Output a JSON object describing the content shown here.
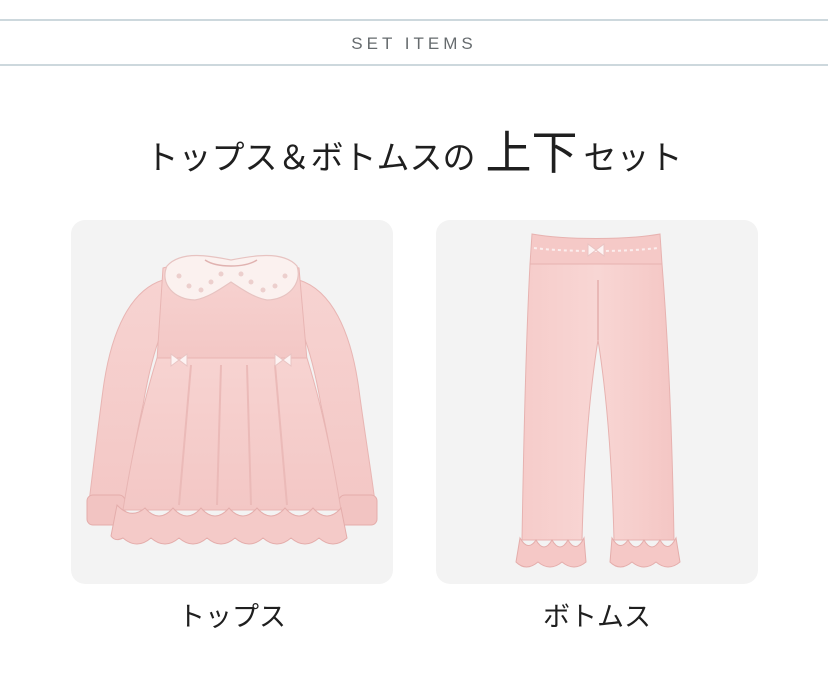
{
  "header": {
    "section_title": "SET ITEMS"
  },
  "headline": {
    "before": "トップス＆ボトムスの",
    "emphasis": "上下",
    "after": "セット"
  },
  "products": [
    {
      "caption": "トップス",
      "image_icon": "pink-fleece-top-image"
    },
    {
      "caption": "ボトムス",
      "image_icon": "pink-fleece-pants-image"
    }
  ],
  "colors": {
    "rule": "#cdd8dd",
    "card_background": "#f3f3f3",
    "garment_pink": "#f6cfcd",
    "garment_shadow": "#e9b7b5",
    "lace": "#fbf3f1"
  }
}
